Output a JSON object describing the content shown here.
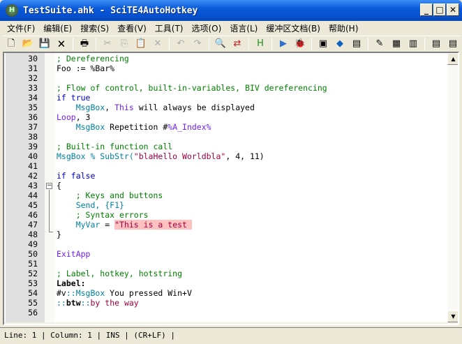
{
  "window": {
    "title": "TestSuite.ahk - SciTE4AutoHotkey",
    "icon": "autohotkey-icon",
    "buttons": [
      "minimize",
      "maximize",
      "close"
    ]
  },
  "menu": [
    "文件(F)",
    "编辑(E)",
    "搜索(S)",
    "查看(V)",
    "工具(T)",
    "选项(O)",
    "语言(L)",
    "缓冲区文档(B)",
    "帮助(H)"
  ],
  "toolbar": [
    "new-file",
    "open-file",
    "save",
    "close-file",
    "print",
    "cut",
    "copy",
    "paste",
    "delete",
    "undo",
    "redo",
    "find",
    "replace",
    "ahk-help",
    "run",
    "debug",
    "inspect",
    "object-browser",
    "window-spy",
    "script-props",
    "tools",
    "toolbox",
    "doc1",
    "doc2"
  ],
  "lines": [
    {
      "n": "30",
      "t": [
        [
          "c",
          "; Dereferencing"
        ]
      ]
    },
    {
      "n": "31",
      "t": [
        [
          "o",
          "Foo := %Bar%"
        ]
      ]
    },
    {
      "n": "32",
      "t": []
    },
    {
      "n": "33",
      "t": [
        [
          "c",
          "; Flow of control, built-in-variables, BIV dereferencing"
        ]
      ]
    },
    {
      "n": "34",
      "t": [
        [
          "k",
          "if true"
        ]
      ]
    },
    {
      "n": "35",
      "t": [
        [
          "o",
          "    "
        ],
        [
          "f",
          "MsgBox"
        ],
        [
          "o",
          ", "
        ],
        [
          "p",
          "This"
        ],
        [
          "o",
          " will always be displayed"
        ]
      ]
    },
    {
      "n": "36",
      "t": [
        [
          "p",
          "Loop"
        ],
        [
          "o",
          ", 3"
        ]
      ]
    },
    {
      "n": "37",
      "t": [
        [
          "o",
          "    "
        ],
        [
          "f",
          "MsgBox"
        ],
        [
          "o",
          " Repetition #"
        ],
        [
          "p",
          "%A_Index%"
        ]
      ]
    },
    {
      "n": "38",
      "t": []
    },
    {
      "n": "39",
      "t": [
        [
          "c",
          "; Built-in function call"
        ]
      ]
    },
    {
      "n": "40",
      "t": [
        [
          "f",
          "MsgBox % SubStr("
        ],
        [
          "s",
          "\"blaHello Worldbla\""
        ],
        [
          "o",
          ", 4, 11)"
        ]
      ]
    },
    {
      "n": "41",
      "t": []
    },
    {
      "n": "42",
      "t": [
        [
          "k",
          "if false"
        ]
      ]
    },
    {
      "n": "43",
      "t": [
        [
          "o",
          "{"
        ]
      ]
    },
    {
      "n": "44",
      "t": [
        [
          "o",
          "    "
        ],
        [
          "c",
          "; Keys and buttons"
        ]
      ]
    },
    {
      "n": "45",
      "t": [
        [
          "o",
          "    "
        ],
        [
          "f",
          "Send, {F1}"
        ]
      ]
    },
    {
      "n": "46",
      "t": [
        [
          "o",
          "    "
        ],
        [
          "c",
          "; Syntax errors"
        ]
      ]
    },
    {
      "n": "47",
      "t": [
        [
          "o",
          "    "
        ],
        [
          "v",
          "MyVar"
        ],
        [
          "o",
          " = "
        ],
        [
          "e",
          "\"This is a test "
        ]
      ]
    },
    {
      "n": "48",
      "t": [
        [
          "o",
          "}"
        ]
      ]
    },
    {
      "n": "49",
      "t": []
    },
    {
      "n": "50",
      "t": [
        [
          "p",
          "ExitApp"
        ]
      ]
    },
    {
      "n": "51",
      "t": []
    },
    {
      "n": "52",
      "t": [
        [
          "c",
          "; Label, hotkey, hotstring"
        ]
      ]
    },
    {
      "n": "53",
      "t": [
        [
          "b",
          "Label:"
        ]
      ]
    },
    {
      "n": "54",
      "t": [
        [
          "o",
          "#v"
        ],
        [
          "f",
          "::MsgBox"
        ],
        [
          "o",
          " You pressed Win+V"
        ]
      ]
    },
    {
      "n": "55",
      "t": [
        [
          "f",
          "::"
        ],
        [
          "b",
          "btw"
        ],
        [
          "f",
          "::"
        ],
        [
          "s",
          "by the way"
        ]
      ]
    },
    {
      "n": "56",
      "t": []
    }
  ],
  "status": "Line: 1 | Column: 1 | INS | (CR+LF) |"
}
